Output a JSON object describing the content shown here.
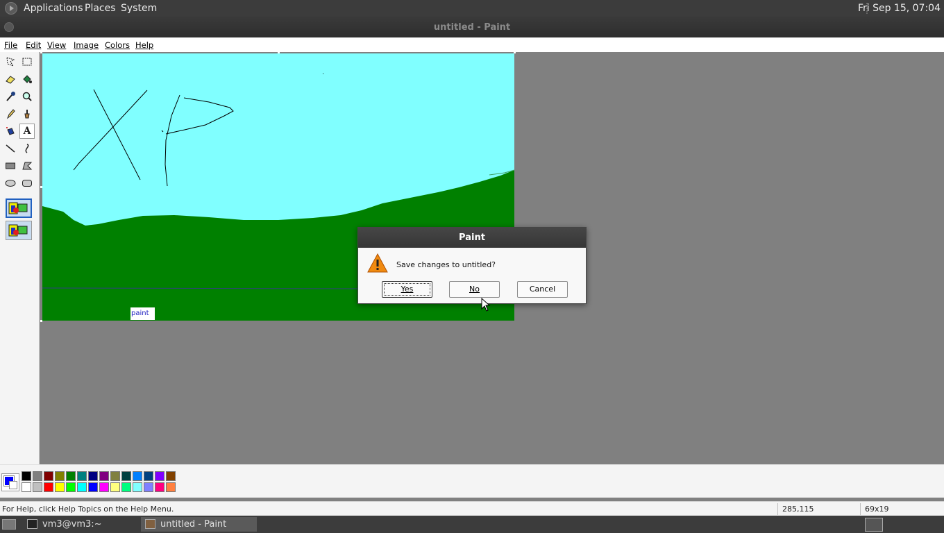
{
  "top_panel": {
    "menus": [
      "Applications",
      "Places",
      "System"
    ],
    "clock": "Fri Sep 15, 07:04"
  },
  "window": {
    "title": "untitled - Paint"
  },
  "menubar": [
    "File",
    "Edit",
    "View",
    "Image",
    "Colors",
    "Help"
  ],
  "tools": [
    "free-select-icon",
    "rect-select-icon",
    "eraser-icon",
    "fill-icon",
    "color-picker-icon",
    "magnifier-icon",
    "pencil-icon",
    "brush-icon",
    "airbrush-icon",
    "text-icon",
    "line-icon",
    "curve-icon",
    "rectangle-icon",
    "polygon-icon",
    "ellipse-icon",
    "rounded-rect-icon"
  ],
  "canvas": {
    "sky_color": "#80ffff",
    "grass_color": "#008000",
    "text_box_content": "paint",
    "text_color": "#2020c0"
  },
  "palette": {
    "foreground": "#0000ff",
    "background": "#ffffff",
    "top_row": [
      "#000000",
      "#808080",
      "#800000",
      "#808000",
      "#008000",
      "#008080",
      "#000080",
      "#800080",
      "#808040",
      "#004040",
      "#0080ff",
      "#004080",
      "#8000ff",
      "#804000"
    ],
    "bottom_row": [
      "#ffffff",
      "#c0c0c0",
      "#ff0000",
      "#ffff00",
      "#00ff00",
      "#00ffff",
      "#0000ff",
      "#ff00ff",
      "#ffff80",
      "#00ff80",
      "#80ffff",
      "#8080ff",
      "#ff0080",
      "#ff8040"
    ]
  },
  "statusbar": {
    "help_text": "For Help, click Help Topics on the Help Menu.",
    "position": "285,115",
    "size": "69x19"
  },
  "taskbar": {
    "tasks": [
      "vm3@vm3:~",
      "untitled - Paint"
    ]
  },
  "dialog": {
    "title": "Paint",
    "message": "Save changes to untitled?",
    "yes_label": "Yes",
    "no_label": "No",
    "cancel_label": "Cancel"
  }
}
